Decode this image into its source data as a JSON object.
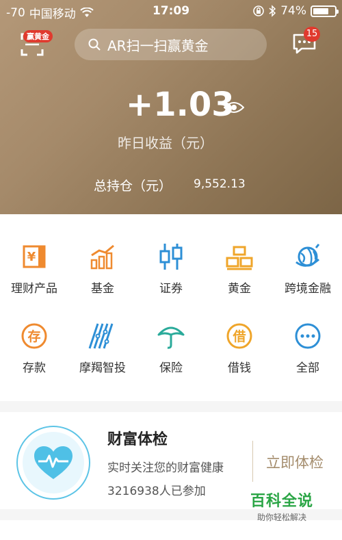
{
  "status_bar": {
    "signal": "-70",
    "carrier": "中国移动",
    "time": "17:09",
    "battery": "74%",
    "battery_level": 0.74
  },
  "header": {
    "scan_badge": "赢黄金",
    "search_placeholder": "AR扫一扫赢黄金",
    "message_count": "15",
    "yield_value": "+1.03",
    "yield_label": "昨日收益（元）",
    "holding_label": "总持仓（元）",
    "holding_value": "9,552.13"
  },
  "grid": {
    "items": [
      {
        "label": "理财产品",
        "icon": "wealth-products-icon",
        "color": "#ef8a2f"
      },
      {
        "label": "基金",
        "icon": "fund-icon",
        "color": "#ef8a2f"
      },
      {
        "label": "证券",
        "icon": "securities-icon",
        "color": "#2d8fd6"
      },
      {
        "label": "黄金",
        "icon": "gold-icon",
        "color": "#efa52a"
      },
      {
        "label": "跨境金融",
        "icon": "cross-border-icon",
        "color": "#2d8fd6"
      },
      {
        "label": "存款",
        "icon": "deposit-icon",
        "color": "#ef8a2f"
      },
      {
        "label": "摩羯智投",
        "icon": "robo-advisor-icon",
        "color": "#2d8fd6"
      },
      {
        "label": "保险",
        "icon": "insurance-icon",
        "color": "#2aaa9a"
      },
      {
        "label": "借钱",
        "icon": "borrow-icon",
        "color": "#efa52a"
      },
      {
        "label": "全部",
        "icon": "all-icon",
        "color": "#2d8fd6"
      }
    ],
    "deposit_glyph": "存",
    "borrow_glyph": "借",
    "wealth_glyph": "¥"
  },
  "checkup": {
    "title": "财富体检",
    "desc": "实时关注您的财富健康",
    "count": "3216938人已参加",
    "button": "立即体检"
  },
  "watermark": {
    "main": "百科全说",
    "sub": "助你轻松解决"
  },
  "colors": {
    "header_bg": "#a58a6a",
    "accent_gold": "#a48c6c",
    "badge_red": "#e03a2e",
    "checkup_blue": "#5cc4e6"
  }
}
